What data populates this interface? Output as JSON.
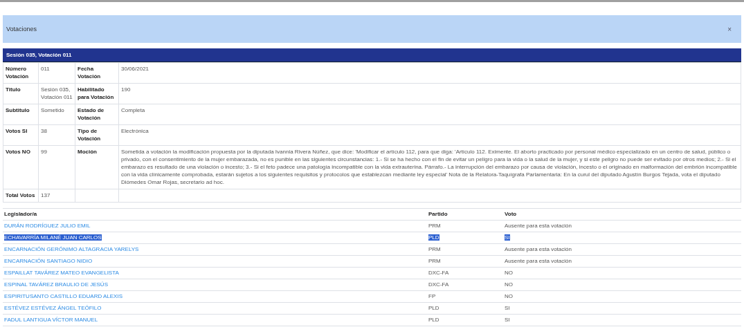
{
  "dialog": {
    "title": "Votaciones",
    "close": "×"
  },
  "details": {
    "heading": "Sesión 035, Votación 011",
    "rows": [
      {
        "label_1": "Número Votación",
        "value_1": "011",
        "label_2": "Fecha Votación",
        "value_2": "30/06/2021"
      },
      {
        "label_1": "Titulo",
        "value_1": "Sesión 035, Votación 011",
        "label_2": "Habilitado para Votación",
        "value_2": "190"
      },
      {
        "label_1": "Subtitulo",
        "value_1": "Sometido",
        "label_2": "Estado de Votación",
        "value_2": "Completa"
      },
      {
        "label_1": "Votos SI",
        "value_1": "38",
        "label_2": "Tipo de Votación",
        "value_2": "Electrónica"
      },
      {
        "label_1": "Votos NO",
        "value_1": "99",
        "label_2": "Moción",
        "value_2": "Sometida a votación la modificación propuesta por la diputada Ivannia Rivera Núñez, que dice: 'Modificar el artículo 112, para que diga: 'Artículo 112. Eximente. El aborto practicado por personal médico especializado en un centro de salud, público o privado, con el consentimiento de la mujer embarazada, no es punible en las siguientes circunstancias: 1.- Si se ha hecho con el fin de evitar un peligro para la vida o la salud de la mujer, y si este peligro no puede ser evitado por otros medios; 2.- Si el embarazo es resultado de una violación o incesto; 3.- Si el feto padece una patología incompatible con la vida extrauterina. Párrafo.- La interrupción del embarazo por causa de violación, incesto o el originado en malformación del embrión incompatible con la vida clínicamente comprobada, estarán sujetos a los siguientes requisitos y protocolos que establezcan mediante ley especial' Nota de la Relatora-Taquígrafa Parlamentaria: En la curul del diputado Agustín Burgos Tejada, vota el diputado Diómedes Omar Rojas, secretario ad hoc."
      },
      {
        "label_1": "Total Votos",
        "value_1": "137"
      }
    ]
  },
  "votes": {
    "columns": [
      "Legislador/a",
      "Partido",
      "Voto"
    ],
    "rows": [
      {
        "name": "DURÁN RODRÍGUEZ JULIO EMIL",
        "party": "PRM",
        "vote": "Ausente para esta votación",
        "selected": false
      },
      {
        "name": "ECHAVARRÍA MILANÉ JUAN CARLOS",
        "party": "PLD",
        "vote": "SI",
        "selected": true
      },
      {
        "name": "ENCARNACIÓN GERÓNIMO ALTAGRACIA YARELYS",
        "party": "PRM",
        "vote": "Ausente para esta votación",
        "selected": false
      },
      {
        "name": "ENCARNACIÓN SANTIAGO NIDIO",
        "party": "PRM",
        "vote": "Ausente para esta votación",
        "selected": false
      },
      {
        "name": "ESPAILLAT TAVÁREZ MATEO EVANGELISTA",
        "party": "DXC-FA",
        "vote": "NO",
        "selected": false
      },
      {
        "name": "ESPINAL TAVÁREZ BRAULIO DE JESÚS",
        "party": "DXC-FA",
        "vote": "NO",
        "selected": false
      },
      {
        "name": "ESPIRITUSANTO CASTILLO EDUARD ALEXIS",
        "party": "FP",
        "vote": "NO",
        "selected": false
      },
      {
        "name": "ESTÉVEZ ESTÉVEZ ÁNGEL TEÓFILO",
        "party": "PLD",
        "vote": "SI",
        "selected": false
      },
      {
        "name": "FADUL LANTIGUA VÍCTOR MANUEL",
        "party": "PLD",
        "vote": "SI",
        "selected": false
      }
    ]
  }
}
